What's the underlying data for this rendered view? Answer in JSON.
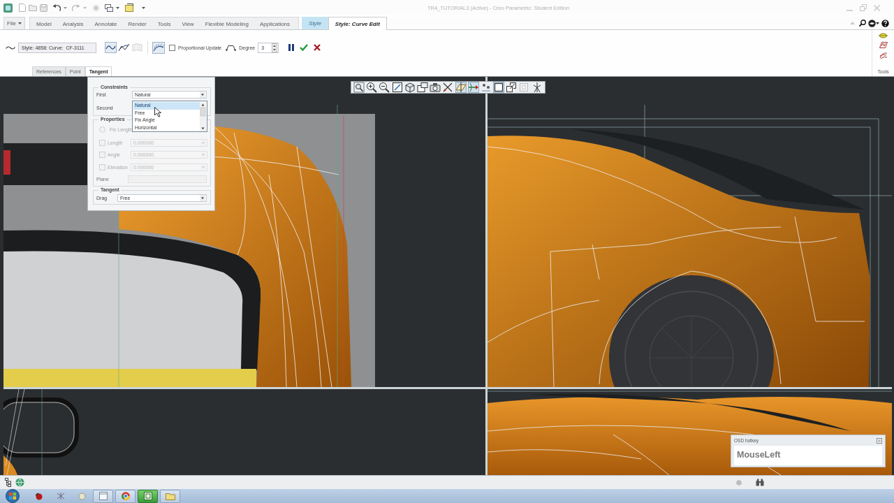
{
  "window": {
    "title": "TR4_TUTORIAL3 (Active) - Creo Parametric: Student Edition"
  },
  "ribbon_tabs": [
    {
      "label": "File",
      "kind": "menu",
      "selected": false
    },
    {
      "label": "Model",
      "kind": "tab",
      "selected": false
    },
    {
      "label": "Analysis",
      "kind": "tab",
      "selected": false
    },
    {
      "label": "Annotate",
      "kind": "tab",
      "selected": false
    },
    {
      "label": "Render",
      "kind": "tab",
      "selected": false
    },
    {
      "label": "Tools",
      "kind": "tab",
      "selected": false
    },
    {
      "label": "View",
      "kind": "tab",
      "selected": false
    },
    {
      "label": "Flexible Modeling",
      "kind": "tab",
      "selected": false
    },
    {
      "label": "Applications",
      "kind": "tab",
      "selected": false
    },
    {
      "label": "Style",
      "kind": "contextual",
      "selected": false
    },
    {
      "label": "Style: Curve Edit",
      "kind": "contextual",
      "selected": true
    }
  ],
  "dashboard": {
    "curve": "Style: 4858: Curve:  CF-3111",
    "curve_tools": [
      {
        "on": true,
        "disabled": false
      },
      {
        "on": false,
        "disabled": false
      },
      {
        "on": false,
        "disabled": true
      }
    ],
    "curvature_display": {
      "on": true
    },
    "proportional_update": {
      "label": "Proportional Update",
      "checked": false
    },
    "degree": {
      "label": "Degree",
      "value": "3"
    }
  },
  "slideup_tabs": [
    {
      "label": "References",
      "selected": false
    },
    {
      "label": "Point",
      "selected": false
    },
    {
      "label": "Tangent",
      "selected": true
    }
  ],
  "tools_group": {
    "label": "Tools"
  },
  "graphics_toolbar": [
    {
      "on": false
    },
    {
      "on": false
    },
    {
      "on": false
    },
    {
      "on": false
    },
    {
      "on": false
    },
    {
      "on": false
    },
    {
      "on": false
    },
    {
      "on": false
    },
    {
      "on": true
    },
    {
      "on": true
    },
    {
      "on": false
    },
    {
      "on": true
    },
    {
      "on": false
    },
    {
      "on": false
    },
    {
      "on": false
    }
  ],
  "tangent_panel": {
    "constraints": {
      "title": "Constraints",
      "first": {
        "label": "First",
        "value": "Natural"
      },
      "second": {
        "label": "Second"
      },
      "options": [
        {
          "label": "Natural",
          "selected": true
        },
        {
          "label": "Free",
          "selected": false
        },
        {
          "label": "Fix Angle",
          "selected": false
        },
        {
          "label": "Horizontal",
          "selected": false
        }
      ]
    },
    "properties": {
      "title": "Properties",
      "fix_length": {
        "label": "Fix Length",
        "checked": false,
        "disabled": true
      },
      "values": [
        {
          "label": "Length",
          "value": "0.000000",
          "checked": false,
          "disabled": true
        },
        {
          "label": "Angle",
          "value": "0.000000",
          "checked": false,
          "disabled": true
        },
        {
          "label": "Elevation",
          "value": "0.000000",
          "checked": false,
          "disabled": true
        }
      ],
      "plane": {
        "label": "Plane",
        "disabled": true
      }
    },
    "tangent": {
      "title": "Tangent",
      "drag": {
        "label": "Drag",
        "value": "Free"
      }
    }
  },
  "osd_hotkey": {
    "title": "OSD hotkey",
    "key": "MouseLeft"
  }
}
